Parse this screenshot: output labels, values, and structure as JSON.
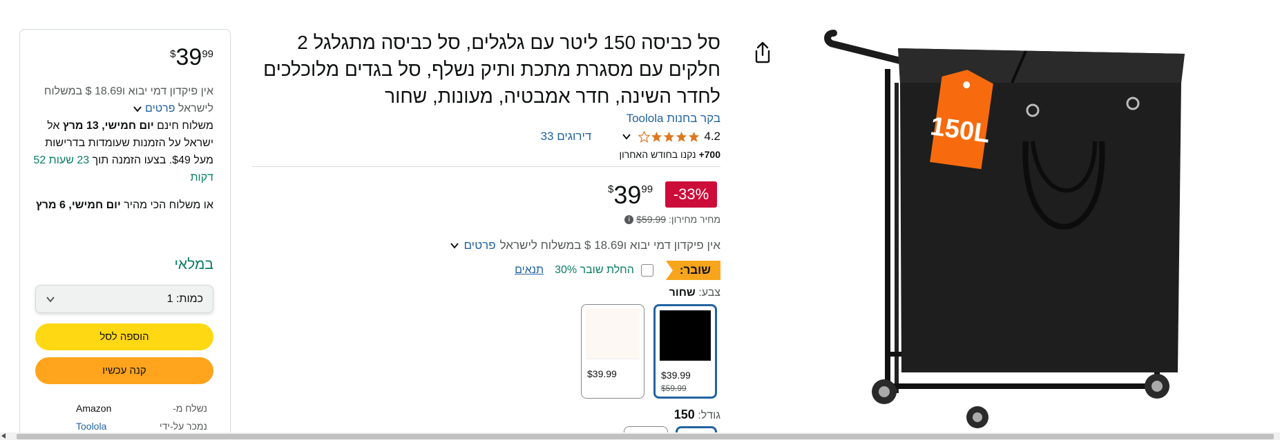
{
  "product": {
    "title": "סל כביסה 150 ליטר עם גלגלים, סל כביסה מתגלגל 2 חלקים עם מסגרת מתכת ותיק נשלף, סל בגדים מלוכלכים לחדר השינה, חדר אמבטיה, מעונות, שחור",
    "store_link": "בקר בחנות Toolola",
    "rating_value": "4.2",
    "ratings_count": "33 דירוגים",
    "bought_count": "700+",
    "bought_text": "נקנו בחודש האחרון",
    "discount": "-33%",
    "price_dollar_sign": "$",
    "price_whole": "39",
    "price_fraction": "99",
    "list_price_label": "מחיר מחירון:",
    "list_price": "$59.99",
    "import_text": "אין פיקדון דמי יבוא ו18.69 $ במשלוח לישראל",
    "details_link": "פרטים",
    "coupon_badge": "שובר:",
    "coupon_text": "החלת שובר 30%",
    "coupon_terms": "תנאים",
    "color_label": "צבע:",
    "color_value": "שחור",
    "size_label": "גודל:",
    "size_value": "150",
    "image_badge": "150L"
  },
  "swatches": [
    {
      "price": "$39.99",
      "old_price": "$59.99",
      "color": "#000000"
    },
    {
      "price": "$39.99",
      "color": "#fdf8f3"
    }
  ],
  "buybox": {
    "price_dollar_sign": "$",
    "price_whole": "39",
    "price_fraction": "99",
    "import_text": "אין פיקדון דמי יבוא ו18.69 $ במשלוח לישראל",
    "details_link": "פרטים",
    "free_ship_prefix": "משלוח חינם",
    "free_ship_day": "יום חמישי, 13 מרץ",
    "free_ship_mid": "אל ישראל על הזמנות שעומדות בדרישות מעל $49. בצעו הזמנה תוך",
    "countdown": "23 שעות 52 דקות",
    "fast_prefix": "או משלוח הכי מהיר",
    "fast_day": "יום חמישי, 6 מרץ",
    "in_stock": "במלאי",
    "qty_label": "כמות:",
    "qty_value": "1",
    "add_to_cart": "הוספה לסל",
    "buy_now": "קנה עכשיו",
    "ships_from_label": "נשלח מ-",
    "ships_from_value": "Amazon",
    "sold_by_label": "נמכר על-ידי",
    "sold_by_value": "Toolola"
  },
  "colors": {
    "link": "#2162a1",
    "deal_red": "#cc0c39",
    "stock_green": "#067d62",
    "add_to_cart": "#ffd814",
    "buy_now": "#ffa41c",
    "coupon": "#f7a51c",
    "badge_orange": "#f76b0e"
  }
}
